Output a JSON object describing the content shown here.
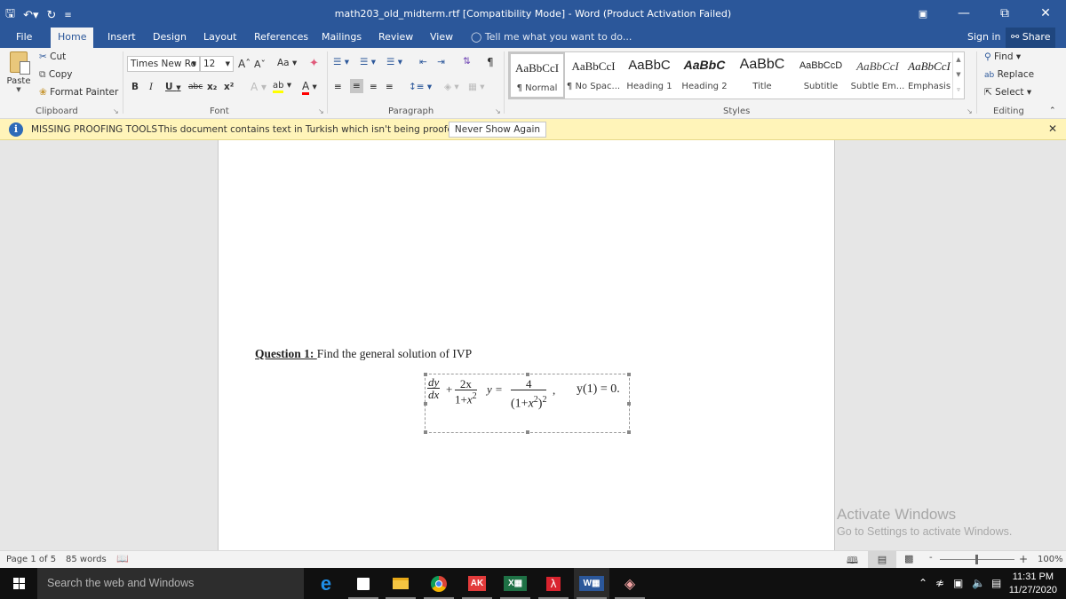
{
  "window": {
    "title": "math203_old_midterm.rtf [Compatibility Mode] - Word (Product Activation Failed)",
    "controls": [
      "ribbon-display-options",
      "minimize",
      "restore",
      "close"
    ]
  },
  "quick_access": {
    "icons": [
      "save-icon",
      "undo-icon",
      "redo-icon",
      "customize-icon"
    ]
  },
  "tabs": [
    {
      "label": "File",
      "active": false
    },
    {
      "label": "Home",
      "active": true
    },
    {
      "label": "Insert",
      "active": false
    },
    {
      "label": "Design",
      "active": false
    },
    {
      "label": "Layout",
      "active": false
    },
    {
      "label": "References",
      "active": false
    },
    {
      "label": "Mailings",
      "active": false
    },
    {
      "label": "Review",
      "active": false
    },
    {
      "label": "View",
      "active": false
    }
  ],
  "tell_me": "Tell me what you want to do...",
  "account": {
    "sign_in": "Sign in",
    "share": "Share"
  },
  "ribbon": {
    "clipboard": {
      "paste": "Paste",
      "cut": "Cut",
      "copy": "Copy",
      "format_painter": "Format Painter",
      "label": "Clipboard"
    },
    "font": {
      "font_name": "Times New Ro",
      "font_size": "12",
      "bold": "B",
      "italic": "I",
      "underline": "U",
      "strike": "abc",
      "subscript": "x₂",
      "superscript": "x²",
      "change_case": "Aa",
      "label": "Font",
      "highlight_color": "#ffff00",
      "font_color": "#ff0000"
    },
    "paragraph": {
      "label": "Paragraph",
      "active_alignment": "center"
    },
    "styles": {
      "label": "Styles",
      "items": [
        {
          "preview": "AaBbCcI",
          "name": "¶ Normal",
          "selected": true
        },
        {
          "preview": "AaBbCcI",
          "name": "¶ No Spac...",
          "selected": false
        },
        {
          "preview": "AaBbC",
          "name": "Heading 1",
          "selected": false
        },
        {
          "preview": "AaBbC",
          "name": "Heading 2",
          "selected": false
        },
        {
          "preview": "AaBbC",
          "name": "Title",
          "selected": false
        },
        {
          "preview": "AaBbCcD",
          "name": "Subtitle",
          "selected": false
        },
        {
          "preview": "AaBbCcI",
          "name": "Subtle Em...",
          "selected": false
        },
        {
          "preview": "AaBbCcI",
          "name": "Emphasis",
          "selected": false
        }
      ]
    },
    "editing": {
      "find": "Find",
      "replace": "Replace",
      "select": "Select",
      "label": "Editing"
    }
  },
  "infobar": {
    "title": "MISSING PROOFING TOOLS",
    "message": "This document contains text in Turkish which isn't being proofed.",
    "button": "Never Show Again"
  },
  "document": {
    "question_label": "Question 1: ",
    "question_text": "Find the general solution of IVP",
    "equation": {
      "lhs_frac1_num": "dy",
      "lhs_frac1_den": "dx",
      "plus": "+",
      "frac2_num": "2x",
      "frac2_den": "1+x2",
      "y_eq": "y =",
      "rhs_num": "4",
      "rhs_den": "(1+x2)2",
      "comma": ",",
      "initial_condition": "y(1) = 0."
    }
  },
  "watermark": {
    "line1": "Activate Windows",
    "line2": "Go to Settings to activate Windows."
  },
  "status": {
    "page": "Page 1 of 5",
    "words": "85 words",
    "zoom": "100%",
    "zoom_percent": 100
  },
  "taskbar": {
    "search_placeholder": "Search the web and Windows",
    "apps": [
      "edge",
      "store",
      "file-explorer",
      "chrome",
      "ak",
      "excel",
      "acrobat",
      "word",
      "other"
    ],
    "time": "11:31 PM",
    "date": "11/27/2020"
  }
}
